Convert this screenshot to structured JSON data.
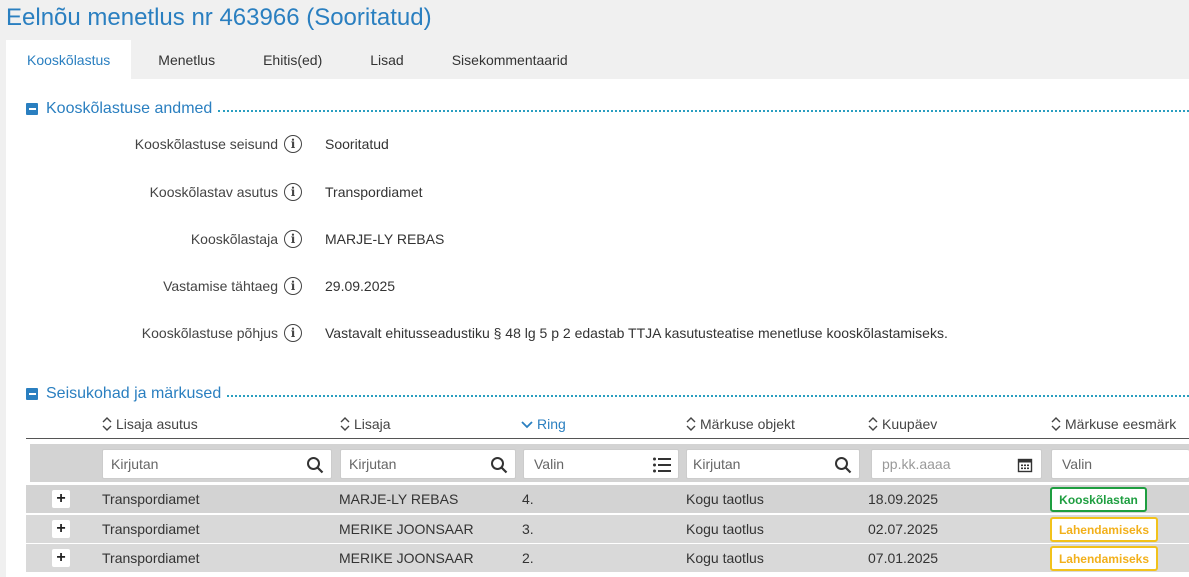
{
  "page": {
    "title": "Eelnõu menetlus nr 463966 (Sooritatud)"
  },
  "tabs": [
    {
      "label": "Kooskõlastus",
      "active": true
    },
    {
      "label": "Menetlus"
    },
    {
      "label": "Ehitis(ed)"
    },
    {
      "label": "Lisad"
    },
    {
      "label": "Sisekommentaarid"
    }
  ],
  "details": {
    "title": "Kooskõlastuse andmed",
    "fields": [
      {
        "label": "Kooskõlastuse seisund",
        "value": "Sooritatud"
      },
      {
        "label": "Kooskõlastav asutus",
        "value": "Transpordiamet"
      },
      {
        "label": "Kooskõlastaja",
        "value": "MARJE-LY REBAS"
      },
      {
        "label": "Vastamise tähtaeg",
        "value": "29.09.2025"
      },
      {
        "label": "Kooskõlastuse põhjus",
        "value": "Vastavalt ehitusseadustiku § 48 lg 5 p 2 edastab TTJA kasutusteatise menetluse kooskõlastamiseks."
      }
    ]
  },
  "remarks": {
    "title": "Seisukohad ja märkused",
    "columns": [
      {
        "label": "Lisaja asutus",
        "sort": "sort-icon"
      },
      {
        "label": "Lisaja",
        "sort": "sort-icon"
      },
      {
        "label": "Ring",
        "sort": "sort-desc-icon"
      },
      {
        "label": "Märkuse objekt",
        "sort": "sort-icon"
      },
      {
        "label": "Kuupäev",
        "sort": "sort-icon"
      },
      {
        "label": "Märkuse eesmärk",
        "sort": "sort-icon"
      }
    ],
    "filters": {
      "asutus_placeholder": "Kirjutan",
      "lisaja_placeholder": "Kirjutan",
      "ring_placeholder": "Valin",
      "objekt_placeholder": "Kirjutan",
      "kuupaev_placeholder": "pp.kk.aaaa",
      "eesmark_placeholder": "Valin"
    },
    "rows": [
      {
        "asutus": "Transpordiamet",
        "lisaja": "MARJE-LY REBAS",
        "ring": "4.",
        "objekt": "Kogu taotlus",
        "kuupaev": "18.09.2025",
        "eesmark": "Kooskõlastan",
        "eesmark_color": "#1e9e40"
      },
      {
        "asutus": "Transpordiamet",
        "lisaja": "MERIKE JOONSAAR",
        "ring": "3.",
        "objekt": "Kogu taotlus",
        "kuupaev": "02.07.2025",
        "eesmark": "Lahendamiseks",
        "eesmark_color": "#f2c21b"
      },
      {
        "asutus": "Transpordiamet",
        "lisaja": "MERIKE JOONSAAR",
        "ring": "2.",
        "objekt": "Kogu taotlus",
        "kuupaev": "07.01.2025",
        "eesmark": "Lahendamiseks",
        "eesmark_color": "#f2c21b"
      }
    ],
    "expand_symbol": "+"
  },
  "colors": {
    "accent": "#2a7fc0",
    "green": "#1e9e40",
    "yellow": "#f2c21b"
  }
}
